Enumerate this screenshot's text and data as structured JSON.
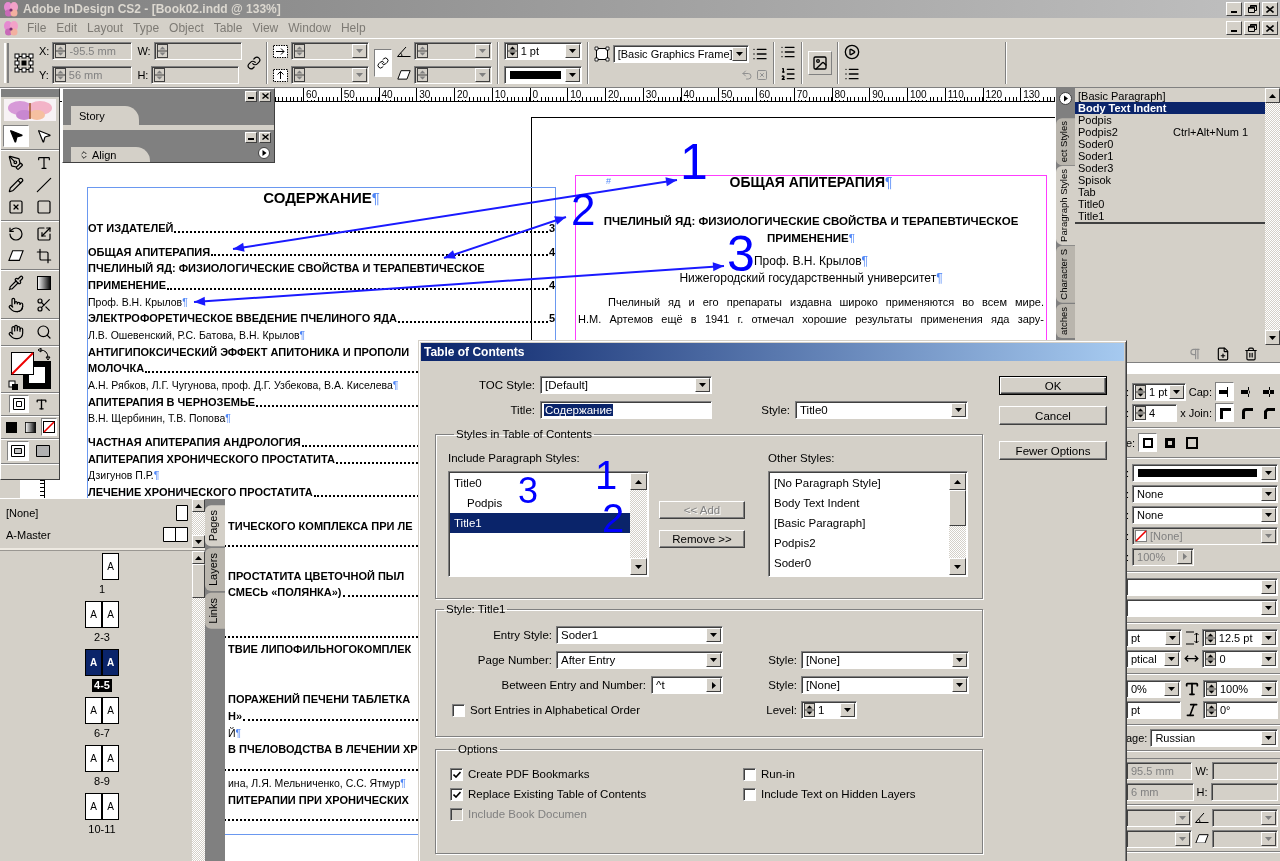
{
  "window": {
    "title": "Adobe InDesign CS2 - [Book02.indd @ 133%]"
  },
  "menu": [
    "File",
    "Edit",
    "Layout",
    "Type",
    "Object",
    "Table",
    "View",
    "Window",
    "Help"
  ],
  "control_bar": {
    "x_label": "X:",
    "x": "-95.5 mm",
    "y_label": "Y:",
    "y": "56 mm",
    "w_label": "W:",
    "h_label": "H:",
    "constrain": true,
    "stroke_weight": "1 pt",
    "object_style": "[Basic Graphics Frame]"
  },
  "ruler": [
    "60",
    "50",
    "40",
    "30",
    "20",
    "10",
    "0",
    "10",
    "20",
    "30",
    "40",
    "50",
    "60",
    "70",
    "80",
    "90",
    "100",
    "110",
    "120",
    "130"
  ],
  "tool_groups": [
    [
      {
        "kind": "select",
        "selected": true
      },
      {
        "kind": "direct",
        "selected": false
      }
    ],
    [
      {
        "kind": "pen",
        "selected": false
      },
      {
        "kind": "type",
        "selected": false
      },
      {
        "kind": "pencil",
        "selected": false
      },
      {
        "kind": "line",
        "selected": false
      },
      {
        "kind": "frame",
        "selected": false
      },
      {
        "kind": "rect",
        "selected": false
      }
    ],
    [
      {
        "kind": "rotate",
        "selected": false
      },
      {
        "kind": "scale",
        "selected": false
      },
      {
        "kind": "shear",
        "selected": false
      },
      {
        "kind": "transform",
        "selected": false
      }
    ],
    [
      {
        "kind": "eyedropper",
        "selected": false
      },
      {
        "kind": "gradient",
        "selected": false
      },
      {
        "kind": "button",
        "selected": false
      },
      {
        "kind": "scissors",
        "selected": false
      }
    ],
    [
      {
        "kind": "hand",
        "selected": false
      },
      {
        "kind": "zoom",
        "selected": false
      }
    ]
  ],
  "format_buttons": [
    {
      "kind": "container",
      "selected": true
    },
    {
      "kind": "text",
      "selected": false
    }
  ],
  "apply_buttons": [
    {
      "kind": "color",
      "selected": false
    },
    {
      "kind": "gradient",
      "selected": false
    },
    {
      "kind": "none",
      "selected": true
    }
  ],
  "view_buttons": [
    {
      "kind": "normal",
      "selected": true
    },
    {
      "kind": "preview",
      "selected": false
    }
  ],
  "floating_panels": [
    {
      "tab": "Story",
      "menu": false
    },
    {
      "tab": "Align",
      "menu": true
    }
  ],
  "toc_page": {
    "lines": [
      {
        "kind": "heading",
        "text": "СОДЕРЖАНИЕ",
        "mark": "¶",
        "spaced": false,
        "cut": false
      },
      {
        "kind": "entry",
        "text": "ОТ ИЗДАТЕЛЕЙ",
        "page": "3",
        "spaced": false,
        "cut": false
      },
      {
        "kind": "entry",
        "text": "ОБЩАЯ АПИТЕРАПИЯ",
        "page": "4",
        "spaced": true,
        "cut": false
      },
      {
        "kind": "title",
        "text": "ПЧЕЛИНЫЙ ЯД: ФИЗИОЛОГИЧЕСКИЕ СВОЙСТВА И ТЕРАПЕВТИЧЕСКОЕ",
        "spaced": false,
        "cut": false
      },
      {
        "kind": "entry",
        "text": "ПРИМЕНЕНИЕ",
        "page": "4",
        "spaced": false,
        "cut": false
      },
      {
        "kind": "author",
        "text": "Проф. В.Н. Крылов",
        "mark": "¶",
        "spaced": false,
        "cut": false
      },
      {
        "kind": "entry",
        "text": "ЭЛЕКТРОФОРЕТИЧЕСКОЕ ВВЕДЕНИЕ ПЧЕЛИНОГО ЯДА",
        "page": "5",
        "spaced": false,
        "cut": false
      },
      {
        "kind": "author",
        "text": "Л.В. Ошевенский, Р.С. Батова, В.Н. Крылов",
        "mark": "¶",
        "spaced": false,
        "cut": false
      },
      {
        "kind": "title",
        "text": "АНТИГИПОКСИЧЕСКИЙ ЭФФЕКТ АПИТОНИКА И ПРОПОЛИ",
        "spaced": false,
        "cut": false
      },
      {
        "kind": "entry",
        "text": "МОЛОЧКА",
        "spaced": false,
        "cut": false
      },
      {
        "kind": "author",
        "text": "А.Н. Рябков, Л.Г. Чугунова, проф. Д.Г. Узбекова, В.А. Киселева",
        "mark": "¶",
        "spaced": false,
        "cut": false
      },
      {
        "kind": "entry",
        "text": "АПИТЕРАПИЯ В ЧЕРНОЗЕМЬЕ",
        "spaced": false,
        "cut": false
      },
      {
        "kind": "author",
        "text": "В.Н. Щербинин, Т.В. Попова",
        "mark": "¶",
        "spaced": false,
        "cut": false
      },
      {
        "kind": "entry",
        "text": "ЧАСТНАЯ АПИТЕРАПИЯ АНДРОЛОГИЯ",
        "spaced": true,
        "cut": false
      },
      {
        "kind": "entry",
        "text": "АПИТЕРАПИЯ ХРОНИЧЕСКОГО ПРОСТАТИТА",
        "spaced": false,
        "cut": false
      },
      {
        "kind": "author",
        "text": "Дзигунов П.Р.",
        "mark": "¶",
        "spaced": false,
        "cut": false
      },
      {
        "kind": "entry",
        "text": "ЛЕЧЕНИЕ ХРОНИЧЕСКОГО ПРОСТАТИТА",
        "spaced": false,
        "cut": false
      },
      {
        "kind": "covered",
        "spaced": false
      },
      {
        "kind": "title",
        "text": "ТИЧЕСКОГО КОМПЛЕКСА ПРИ ЛЕ",
        "spaced": false,
        "cut": true
      },
      {
        "kind": "leader",
        "spaced": false
      },
      {
        "kind": "covered",
        "spaced": false
      },
      {
        "kind": "title",
        "text": "ПРОСТАТИТА ЦВЕТОЧНОЙ ПЫЛ",
        "spaced": false,
        "cut": true
      },
      {
        "kind": "entry",
        "text": "СМЕСЬ «ПОЛЯНКА»)",
        "spaced": false,
        "cut": true
      },
      {
        "kind": "covered",
        "spaced": false
      },
      {
        "kind": "leader",
        "spaced": true
      },
      {
        "kind": "title",
        "text": "ТВИЕ ЛИПОФИЛЬНОГОКОМПЛЕК",
        "spaced": false,
        "cut": true
      },
      {
        "kind": "covered",
        "spaced": false
      },
      {
        "kind": "covered",
        "spaced": false
      },
      {
        "kind": "title",
        "text": "ПОРАЖЕНИЙ ПЕЧЕНИ ТАБЛЕТКА",
        "spaced": false,
        "cut": true
      },
      {
        "kind": "entry",
        "text": "Н»",
        "spaced": false,
        "cut": true
      },
      {
        "kind": "author",
        "text": "Й",
        "mark": "¶",
        "spaced": false,
        "cut": true
      },
      {
        "kind": "title",
        "text": "В ПЧЕЛОВОДСТВА В ЛЕЧЕНИИ ХР",
        "spaced": false,
        "cut": true
      },
      {
        "kind": "leader",
        "spaced": false
      },
      {
        "kind": "author",
        "text": "ина, Л.Я. Мельниченко, С.С. Ятмур",
        "mark": "¶",
        "spaced": false,
        "cut": true
      },
      {
        "kind": "title",
        "text": "ПИТЕРАПИИ ПРИ ХРОНИЧЕСКИХ",
        "spaced": false,
        "cut": true
      },
      {
        "kind": "leader",
        "spaced": false
      }
    ]
  },
  "article_page": {
    "marker": "#",
    "heading": "ОБЩАЯ АПИТЕРАПИЯ",
    "heading_mark": "¶",
    "title_lines": [
      "ПЧЕЛИНЫЙ ЯД: ФИЗИОЛОГИЧЕСКИЕ СВОЙСТВА И ТЕРАПЕВТИЧЕСКОЕ",
      "ПРИМЕНЕНИЕ"
    ],
    "title_mark": "¶",
    "author": "Проф. В.Н. Крылов",
    "author_mark": "¶",
    "affiliation": "Нижегородский государственный университет",
    "affiliation_mark": "¶",
    "body_lines": [
      "Пчелиный яд и его препараты издавна широко применяются во всем мире.",
      "Н.М. Артемов ещё в 1941 г. отмечал хорошие результаты применения яда зару-"
    ]
  },
  "paragraph_styles": {
    "tabs": [
      {
        "label": "ect Styles",
        "selected": false
      },
      {
        "label": "Paragraph Styles",
        "selected": true
      },
      {
        "label": "Character S",
        "selected": false
      },
      {
        "label": "atches",
        "selected": false
      }
    ],
    "items": [
      {
        "name": "[Basic Paragraph]",
        "selected": false
      },
      {
        "name": "Body Text Indent",
        "selected": true
      },
      {
        "name": "Podpis",
        "selected": false
      },
      {
        "name": "Podpis2",
        "shortcut": "Ctrl+Alt+Num 1",
        "selected": false
      },
      {
        "name": "Soder0",
        "selected": false
      },
      {
        "name": "Soder1",
        "selected": false
      },
      {
        "name": "Soder3",
        "selected": false
      },
      {
        "name": "Spisok",
        "selected": false
      },
      {
        "name": "Tab",
        "selected": false
      },
      {
        "name": "Title0",
        "selected": false
      },
      {
        "name": "Title1",
        "selected": false
      }
    ]
  },
  "side_panel": {
    "sections": [
      [
        [
          {
            "kind": "label",
            "text": ":"
          },
          {
            "kind": "spindrop",
            "value": "1 pt",
            "disabled": false
          },
          {
            "kind": "label",
            "text": "Cap:"
          },
          {
            "kind": "butt",
            "selected": true
          },
          {
            "kind": "roundcap",
            "selected": false
          },
          {
            "kind": "squarecap",
            "selected": false
          }
        ],
        [
          {
            "kind": "label",
            "text": ":"
          },
          {
            "kind": "spin",
            "value": "4",
            "disabled": false
          },
          {
            "kind": "label",
            "text": "x"
          },
          {
            "kind": "label",
            "text": "Join:"
          },
          {
            "kind": "miter",
            "selected": true
          },
          {
            "kind": "roundjoin",
            "selected": false
          },
          {
            "kind": "bevel",
            "selected": false
          }
        ]
      ],
      [
        [
          {
            "kind": "label",
            "text": "e:"
          },
          {
            "kind": "center",
            "selected": true
          },
          {
            "kind": "inside",
            "selected": false
          },
          {
            "kind": "outside",
            "selected": false
          }
        ]
      ],
      [
        [
          {
            "kind": "label",
            "text": ":"
          },
          {
            "kind": "line"
          }
        ],
        [
          {
            "kind": "label",
            "text": ":"
          },
          {
            "kind": "drop",
            "value": "None",
            "disabled": false
          }
        ],
        [
          {
            "kind": "label",
            "text": ":"
          },
          {
            "kind": "drop",
            "value": "None",
            "disabled": false
          }
        ],
        [
          {
            "kind": "label",
            "text": ":"
          },
          {
            "kind": "swatch",
            "value": "[None]",
            "disabled": true
          }
        ],
        [
          {
            "kind": "label",
            "text": ":"
          },
          {
            "kind": "tint",
            "value": "100%",
            "disabled": true
          }
        ]
      ],
      [
        [
          {
            "kind": "drop",
            "disabled": false
          }
        ],
        [
          {
            "kind": "drop",
            "disabled": false
          }
        ]
      ],
      [
        [
          {
            "kind": "drop",
            "value": "pt",
            "disabled": false
          },
          {
            "kind": "leading"
          },
          {
            "kind": "spindrop",
            "value": "12.5 pt",
            "disabled": false
          }
        ],
        [
          {
            "kind": "drop",
            "value": "ptical",
            "disabled": false
          },
          {
            "kind": "kerning"
          },
          {
            "kind": "spindrop",
            "value": "0",
            "disabled": false
          }
        ]
      ],
      [
        [
          {
            "kind": "drop",
            "value": "0%",
            "disabled": false
          },
          {
            "kind": "scale"
          },
          {
            "kind": "spindrop",
            "value": "100%",
            "disabled": false
          }
        ],
        [
          {
            "kind": "field",
            "value": "pt",
            "disabled": false
          },
          {
            "kind": "skew"
          },
          {
            "kind": "spin",
            "value": "0°",
            "disabled": false
          }
        ]
      ],
      [
        [
          {
            "kind": "label",
            "text": "age:"
          },
          {
            "kind": "drop",
            "value": "Russian",
            "disabled": false
          }
        ]
      ],
      [
        [
          {
            "kind": "field",
            "value": "95.5 mm",
            "disabled": true
          },
          {
            "kind": "label",
            "text": "W:"
          },
          {
            "kind": "field",
            "disabled": true
          }
        ],
        [
          {
            "kind": "field",
            "value": "6 mm",
            "disabled": true
          },
          {
            "kind": "label",
            "text": "H:"
          },
          {
            "kind": "field",
            "disabled": true
          }
        ]
      ],
      [
        [
          {
            "kind": "drop",
            "disabled": true
          },
          {
            "kind": "angle"
          },
          {
            "kind": "drop",
            "disabled": true
          }
        ],
        [
          {
            "kind": "drop",
            "disabled": true
          },
          {
            "kind": "shear"
          },
          {
            "kind": "drop",
            "disabled": true
          }
        ]
      ]
    ]
  },
  "pages_panel": {
    "masters": [
      {
        "label": "[None]",
        "kind": "single"
      },
      {
        "label": "A-Master",
        "kind": "spread"
      }
    ],
    "spreads": [
      {
        "label": "1",
        "pages": [
          "A"
        ],
        "selected": false
      },
      {
        "label": "2-3",
        "pages": [
          "A",
          "A"
        ],
        "selected": false
      },
      {
        "label": "4-5",
        "pages": [
          "A",
          "A"
        ],
        "selected": true
      },
      {
        "label": "6-7",
        "pages": [
          "A",
          "A"
        ],
        "selected": false
      },
      {
        "label": "8-9",
        "pages": [
          "A",
          "A"
        ],
        "selected": false
      },
      {
        "label": "10-11",
        "pages": [
          "A",
          "A"
        ],
        "selected": false
      }
    ],
    "tabs": [
      {
        "label": "Pages",
        "selected": true
      },
      {
        "label": "Layers",
        "selected": false
      },
      {
        "label": "Links",
        "selected": false
      }
    ]
  },
  "dialog": {
    "title": "Table of Contents",
    "toc_style_label": "TOC Style:",
    "toc_style": "[Default]",
    "title_field": {
      "label": "Title:",
      "value": "Содержание",
      "selected": true
    },
    "style_label": "Style:",
    "title_style": "Title0",
    "buttons": [
      {
        "label": "OK",
        "kind": "default"
      },
      {
        "label": "Cancel",
        "kind": "normal"
      },
      {
        "label": "Fewer Options",
        "kind": "normal"
      }
    ],
    "styles_group": {
      "legend": "Styles in Table of Contents",
      "include_label": "Include Paragraph Styles:",
      "included": [
        {
          "label": "Title0",
          "selected": false,
          "children": [
            {
              "label": "Podpis",
              "selected": false
            }
          ]
        },
        {
          "label": "Title1",
          "selected": true
        }
      ],
      "add_button": {
        "label": "<< Add",
        "disabled": true
      },
      "remove_button": {
        "label": "Remove >>",
        "disabled": false
      },
      "other_label": "Other Styles:",
      "other": [
        {
          "label": "[No Paragraph Style]",
          "selected": false
        },
        {
          "label": "Body Text Indent",
          "selected": false
        },
        {
          "label": "[Basic Paragraph]",
          "selected": false
        },
        {
          "label": "Podpis2",
          "selected": false
        },
        {
          "label": "Soder0",
          "selected": false
        }
      ]
    },
    "style_group": {
      "legend": "Style: Title1",
      "entry_style_label": "Entry Style:",
      "entry_style": "Soder1",
      "page_number_label": "Page Number:",
      "page_number": "After Entry",
      "page_style_label": "Style:",
      "page_style": "[None]",
      "between_label": "Between Entry and Number:",
      "between": "^t",
      "between_style_label": "Style:",
      "between_style": "[None]",
      "sort": {
        "label": "Sort Entries in Alphabetical Order",
        "checked": false
      },
      "level_label": "Level:",
      "level": "1"
    },
    "options": {
      "legend": "Options",
      "checks": [
        {
          "label": "Create PDF Bookmarks",
          "checked": true,
          "disabled": false
        },
        {
          "label": "Run-in",
          "checked": false,
          "disabled": false
        },
        {
          "label": "Replace Existing Table of Contents",
          "checked": true,
          "disabled": false
        },
        {
          "label": "Include Text on Hidden Layers",
          "checked": false,
          "disabled": false
        },
        {
          "label": "Include Book Documen",
          "checked": false,
          "disabled": true
        }
      ]
    }
  },
  "annotations": [
    {
      "label": "1"
    },
    {
      "label": "2"
    },
    {
      "label": "3"
    },
    {
      "label": "1"
    },
    {
      "label": "3"
    },
    {
      "label": "2"
    }
  ]
}
